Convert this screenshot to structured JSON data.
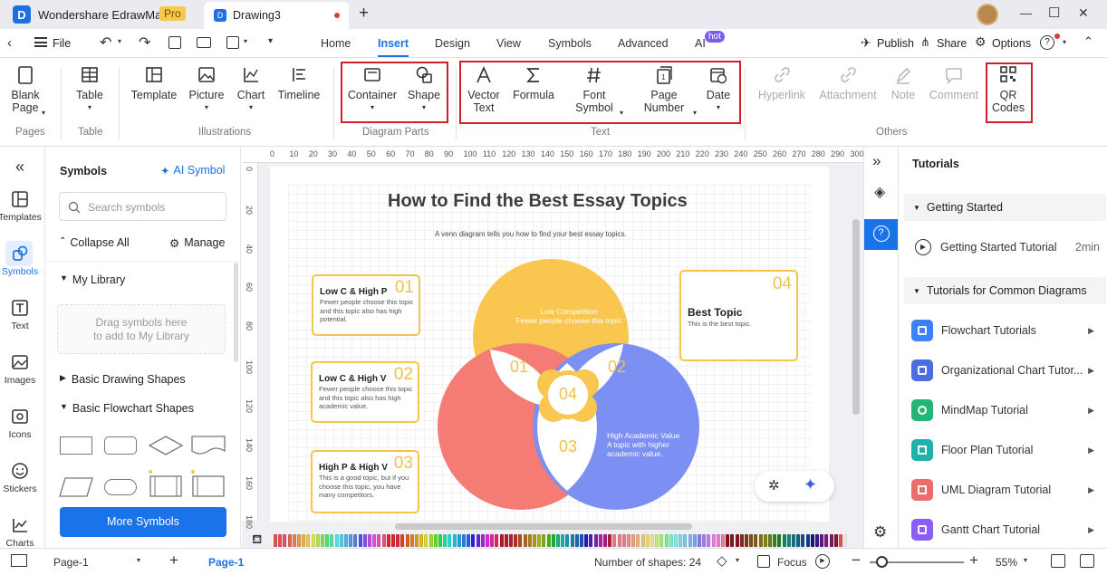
{
  "titlebar": {
    "app_name": "Wondershare EdrawMax",
    "pro_badge": "Pro",
    "doc_tab": "Drawing3",
    "new_tab": "+",
    "minimize": "—",
    "maximize": "☐",
    "close": "✕"
  },
  "menubar": {
    "file": "File",
    "tabs": [
      "Home",
      "Insert",
      "Design",
      "View",
      "Symbols",
      "Advanced",
      "AI"
    ],
    "active_tab": "Insert",
    "ai_badge": "hot",
    "publish": "Publish",
    "share": "Share",
    "options": "Options",
    "help": "?"
  },
  "ribbon": {
    "blank_page": "Blank\nPage",
    "table": "Table",
    "template": "Template",
    "picture": "Picture",
    "chart": "Chart",
    "timeline": "Timeline",
    "container": "Container",
    "shape": "Shape",
    "vector_text": "Vector\nText",
    "formula": "Formula",
    "font_symbol": "Font\nSymbol",
    "page_number": "Page\nNumber",
    "date": "Date",
    "hyperlink": "Hyperlink",
    "attachment": "Attachment",
    "note": "Note",
    "comment": "Comment",
    "qr_codes": "QR\nCodes",
    "groups": {
      "pages": "Pages",
      "table": "Table",
      "illustrations": "Illustrations",
      "diagram_parts": "Diagram Parts",
      "text": "Text",
      "others": "Others"
    }
  },
  "leftnav": [
    {
      "label": "",
      "icon": "collapse-icon"
    },
    {
      "label": "Templates",
      "icon": "templates-icon"
    },
    {
      "label": "Symbols",
      "icon": "symbols-icon"
    },
    {
      "label": "Text",
      "icon": "text-icon"
    },
    {
      "label": "Images",
      "icon": "images-icon"
    },
    {
      "label": "Icons",
      "icon": "icons-icon"
    },
    {
      "label": "Stickers",
      "icon": "stickers-icon"
    },
    {
      "label": "Charts",
      "icon": "charts-icon"
    }
  ],
  "symbols_panel": {
    "title": "Symbols",
    "ai_symbol": "AI Symbol",
    "search_placeholder": "Search symbols",
    "collapse_all": "Collapse All",
    "manage": "Manage",
    "my_library": "My Library",
    "drag_hint": "Drag symbols here\nto add to My Library",
    "basic_drawing": "Basic Drawing Shapes",
    "basic_flowchart": "Basic Flowchart Shapes",
    "more_symbols": "More Symbols"
  },
  "ruler": {
    "top": [
      "0",
      "10",
      "20",
      "30",
      "40",
      "50",
      "60",
      "70",
      "80",
      "90",
      "100",
      "110",
      "120",
      "130",
      "140",
      "150",
      "160",
      "170",
      "180",
      "190",
      "200",
      "210",
      "220",
      "230",
      "240",
      "250",
      "260",
      "270",
      "280",
      "290",
      "300"
    ],
    "left": [
      "0",
      "20",
      "40",
      "60",
      "80",
      "100",
      "120",
      "140",
      "160",
      "180"
    ]
  },
  "diagram": {
    "title": "How to Find the Best Essay Topics",
    "subtitle": "A venn diagram tells you how to find your best essay topics.",
    "top_circle": "Low Competition\nFewer people choose this topic",
    "right_circle": "High Academic Value\nA topic with higher\nacademic value.",
    "n01": "01",
    "n02": "02",
    "n03": "03",
    "n04": "04",
    "cards": [
      {
        "heading": "Low C & High P",
        "desc": "Fewer people choose this topic and this topic also has high potential.",
        "num": "01"
      },
      {
        "heading": "Low C & High V",
        "desc": "Fewer people choose this topic and this topic also has high academic value.",
        "num": "02"
      },
      {
        "heading": "High P & High V",
        "desc": "This is a good topic, but if you choose this topic, you have many competitors.",
        "num": "03"
      }
    ],
    "best": {
      "heading": "Best Topic",
      "desc": "This is the best topic.",
      "num": "04"
    },
    "colors": {
      "yellow": "#f9c74f",
      "red": "#f47c74",
      "blue": "#7b90f2",
      "card_border": "#f4c44f"
    }
  },
  "tutorials": {
    "title": "Tutorials",
    "getting_started": "Getting Started",
    "gs_tutorial": "Getting Started Tutorial",
    "gs_time": "2min",
    "common": "Tutorials for Common Diagrams",
    "items": [
      {
        "label": "Flowchart Tutorials",
        "color": "#3b82f6"
      },
      {
        "label": "Organizational Chart Tutor...",
        "color": "#4a6ee0"
      },
      {
        "label": "MindMap Tutorial",
        "color": "#22b573"
      },
      {
        "label": "Floor Plan Tutorial",
        "color": "#20b2aa"
      },
      {
        "label": "UML Diagram Tutorial",
        "color": "#ee6b6b"
      },
      {
        "label": "Gantt Chart Tutorial",
        "color": "#8b5cf6"
      }
    ]
  },
  "statusbar": {
    "page_select": "Page-1",
    "add": "+",
    "page_tab": "Page-1",
    "shapes": "Number of shapes: 24",
    "focus": "Focus",
    "zoom": "55%"
  }
}
